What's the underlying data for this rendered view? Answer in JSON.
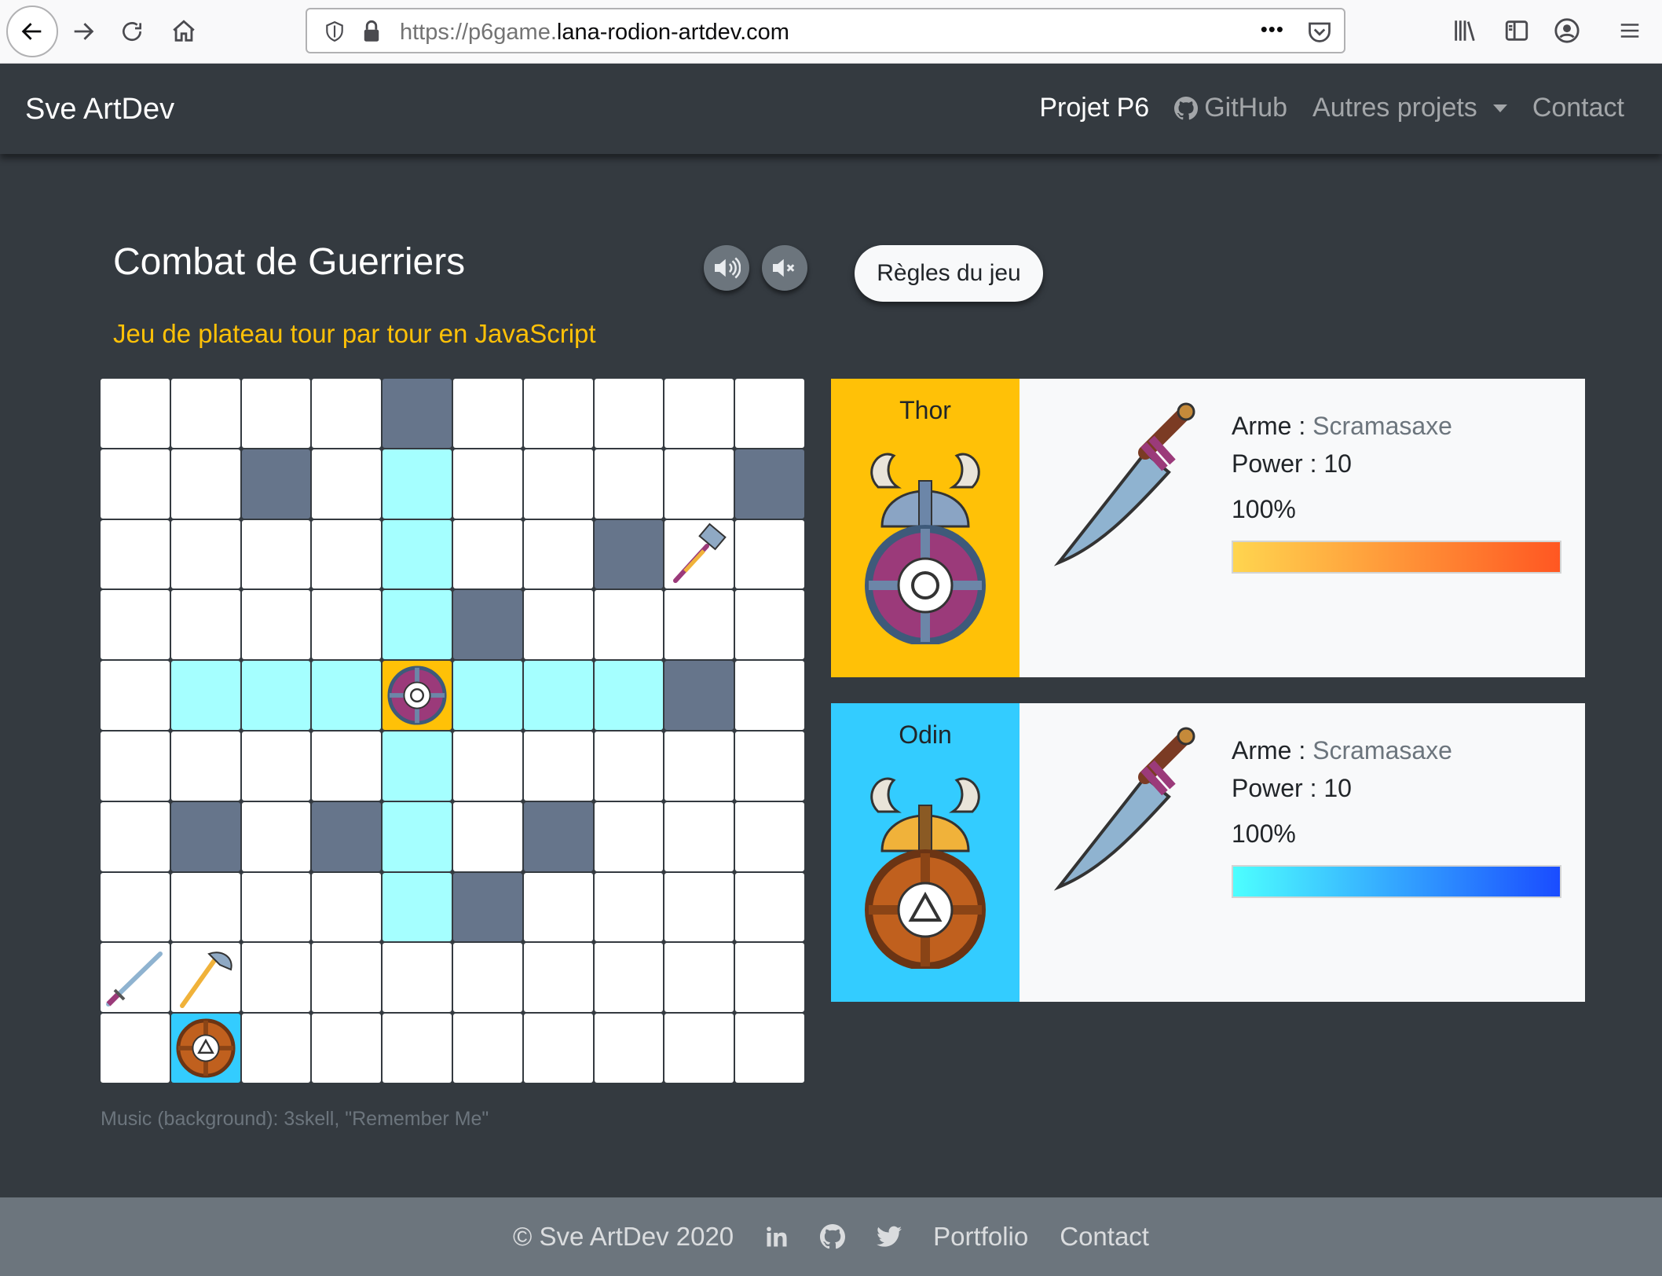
{
  "browser": {
    "url_scheme": "https://p6game.",
    "url_domain": "lana-rodion-artdev.com",
    "more": "•••"
  },
  "navbar": {
    "brand": "Sve ArtDev",
    "links": [
      "Projet P6",
      "GitHub",
      "Autres projets",
      "Contact"
    ]
  },
  "main": {
    "title": "Combat de Guerriers",
    "subtitle": "Jeu de plateau tour par tour en JavaScript",
    "rules_button": "Règles du jeu",
    "credit": "Music (background): 3skell, \"Remember Me\""
  },
  "board": {
    "rows": 10,
    "cols": 10,
    "cells": [
      [
        "empty",
        "empty",
        "empty",
        "empty",
        "wall",
        "empty",
        "empty",
        "empty",
        "empty",
        "empty"
      ],
      [
        "empty",
        "empty",
        "wall",
        "empty",
        "move",
        "empty",
        "empty",
        "empty",
        "empty",
        "wall"
      ],
      [
        "empty",
        "empty",
        "empty",
        "empty",
        "move",
        "empty",
        "empty",
        "wall",
        "hammer",
        "empty"
      ],
      [
        "empty",
        "empty",
        "empty",
        "empty",
        "move",
        "wall",
        "empty",
        "empty",
        "empty",
        "empty"
      ],
      [
        "empty",
        "move",
        "move",
        "move",
        "player1",
        "move",
        "move",
        "move",
        "wall",
        "empty"
      ],
      [
        "empty",
        "empty",
        "empty",
        "empty",
        "move",
        "empty",
        "empty",
        "empty",
        "empty",
        "empty"
      ],
      [
        "empty",
        "wall",
        "empty",
        "wall",
        "move",
        "empty",
        "wall",
        "empty",
        "empty",
        "empty"
      ],
      [
        "empty",
        "empty",
        "empty",
        "empty",
        "move",
        "wall",
        "empty",
        "empty",
        "empty",
        "empty"
      ],
      [
        "sword",
        "axe",
        "empty",
        "empty",
        "empty",
        "empty",
        "empty",
        "empty",
        "empty",
        "empty"
      ],
      [
        "empty",
        "player2",
        "empty",
        "empty",
        "empty",
        "empty",
        "empty",
        "empty",
        "empty",
        "empty"
      ]
    ]
  },
  "players": [
    {
      "name": "Thor",
      "weapon_label": "Arme : ",
      "weapon": "Scramasaxe",
      "power_label": "Power : 10",
      "health": "100%",
      "health_value": 100,
      "color": "#ffc107",
      "shield_color": "#9b3a7a",
      "bar_from": "#ffd54f",
      "bar_to": "#ff5722"
    },
    {
      "name": "Odin",
      "weapon_label": "Arme : ",
      "weapon": "Scramasaxe",
      "power_label": "Power : 10",
      "health": "100%",
      "health_value": 100,
      "color": "#33ccff",
      "shield_color": "#c0601e",
      "bar_from": "#4dffff",
      "bar_to": "#1a4cff"
    }
  ],
  "footer": {
    "copyright": "© Sve ArtDev 2020",
    "portfolio": "Portfolio",
    "contact": "Contact",
    "icons": [
      "linkedin-icon",
      "github-icon",
      "twitter-icon"
    ]
  }
}
